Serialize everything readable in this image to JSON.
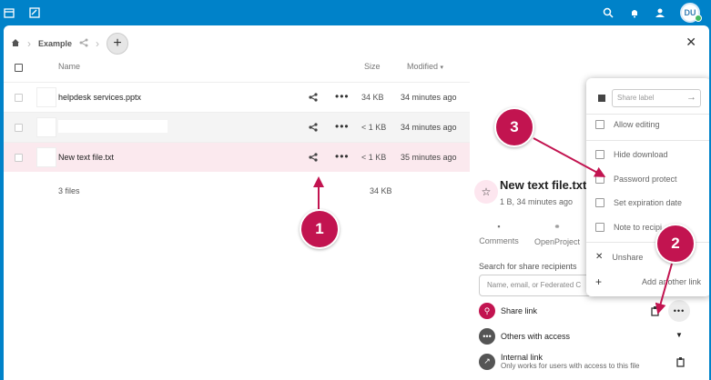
{
  "topbar": {
    "avatar_initials": "DU"
  },
  "breadcrumb": {
    "folder": "Example"
  },
  "columns": {
    "name": "Name",
    "size": "Size",
    "modified": "Modified"
  },
  "files": [
    {
      "name": "helpdesk services.pptx",
      "size": "34 KB",
      "modified": "34 minutes ago"
    },
    {
      "name": "",
      "size": "< 1 KB",
      "modified": "34 minutes ago"
    },
    {
      "name": "New text file.txt",
      "size": "< 1 KB",
      "modified": "35 minutes ago"
    }
  ],
  "summary": {
    "count": "3 files",
    "total_size": "34 KB"
  },
  "sidebar": {
    "title": "New text file.txt",
    "subtitle": "1 B, 34 minutes ago",
    "tabs": [
      "Comments",
      "OpenProject"
    ],
    "search_label": "Search for share recipients",
    "search_placeholder": "Name, email, or Federated C",
    "share_link": "Share link",
    "others_with_access": "Others with access",
    "internal_link": "Internal link",
    "internal_link_sub": "Only works for users with access to this file"
  },
  "popup": {
    "share_label_placeholder": "Share label",
    "allow_editing": "Allow editing",
    "hide_download": "Hide download",
    "password_protect": "Password protect",
    "set_expiration_date": "Set expiration date",
    "note_to_recipient": "Note to recipi",
    "unshare": "Unshare",
    "add_another_link": "Add another link"
  },
  "callouts": [
    "1",
    "2",
    "3"
  ],
  "colors": {
    "brand": "#0082c9",
    "accent": "#c21450",
    "highlight_row": "#fbe9ee"
  }
}
